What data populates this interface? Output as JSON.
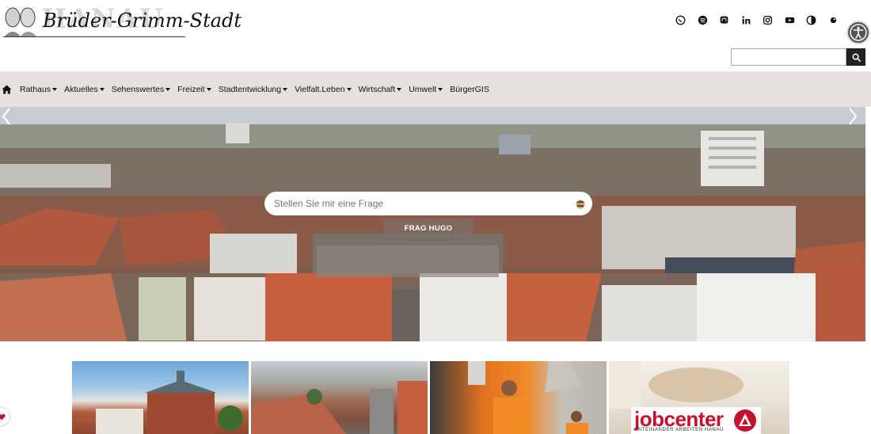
{
  "header": {
    "logo_big": "HANAU",
    "logo_script": "Brüder-Grimm-Stadt"
  },
  "social": [
    "whatsapp-icon",
    "spotify-icon",
    "mastodon-icon",
    "linkedin-icon",
    "instagram-icon",
    "youtube-icon",
    "contrast-icon",
    "adjust-icon"
  ],
  "search": {
    "value": "",
    "placeholder": ""
  },
  "nav": {
    "items": [
      {
        "label": "Rathaus",
        "dropdown": true
      },
      {
        "label": "Aktuelles",
        "dropdown": true
      },
      {
        "label": "Sehenswertes",
        "dropdown": true
      },
      {
        "label": "Freizeit",
        "dropdown": true
      },
      {
        "label": "Stadtentwicklung",
        "dropdown": true
      },
      {
        "label": "Vielfalt.Leben",
        "dropdown": true
      },
      {
        "label": "Wirtschaft",
        "dropdown": true
      },
      {
        "label": "Umwelt",
        "dropdown": true
      },
      {
        "label": "BürgerGIS",
        "dropdown": false
      }
    ]
  },
  "hero": {
    "ask_placeholder": "Stellen Sie mir eine Frage",
    "ask_button": "FRAG HUGO"
  },
  "tiles": {
    "jobcenter_logo": "jobcenter",
    "jobcenter_sub": "MITEINANDER ARBEITEN HANAU"
  },
  "colors": {
    "nav_bg": "#e6e1df",
    "jobcenter_red": "#c8102e"
  }
}
